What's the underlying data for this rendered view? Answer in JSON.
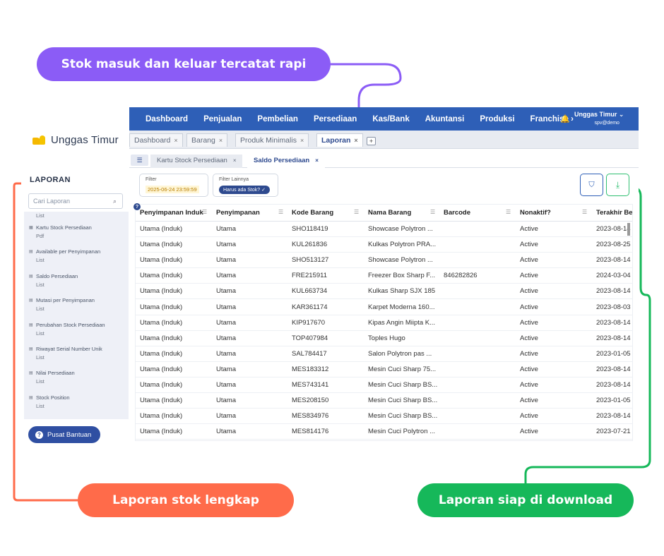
{
  "callouts": {
    "top": "Stok masuk dan keluar tercatat rapi",
    "left": "Laporan stok lengkap",
    "right": "Laporan siap di download"
  },
  "colors": {
    "purple": "#8b5cf6",
    "orange": "#ff6b4a",
    "green": "#16b85a",
    "nav_blue": "#2e5fb7"
  },
  "sidebar": {
    "logo": "Unggas Timur",
    "section_title": "LAPORAN",
    "search_placeholder": "Cari Laporan",
    "search_icon": "search-icon",
    "items": [
      {
        "title": "",
        "sub": "List"
      },
      {
        "title": "Kartu Stock Persediaan",
        "sub": "Pdf"
      },
      {
        "title": "Available per Penyimpanan",
        "sub": "List"
      },
      {
        "title": "Saldo Persediaan",
        "sub": "List"
      },
      {
        "title": "Mutasi per Penyimpanan",
        "sub": "List"
      },
      {
        "title": "Perubahan Stock Persediaan",
        "sub": "List"
      },
      {
        "title": "Riwayat Serial Number Unik",
        "sub": "List"
      },
      {
        "title": "Nilai Persediaan",
        "sub": "List"
      },
      {
        "title": "Stock Position",
        "sub": "List"
      }
    ],
    "help_button": "Pusat Bantuan"
  },
  "topnav": {
    "items": [
      "Dashboard",
      "Penjualan",
      "Pembelian",
      "Persediaan",
      "Kas/Bank",
      "Akuntansi",
      "Produksi",
      "Franchise ›"
    ],
    "user_name": "Unggas Timur ⌄",
    "user_email": "spv@demo"
  },
  "tabs": [
    {
      "label": "Dashboard",
      "close": "×"
    },
    {
      "label": "Barang",
      "close": "×"
    },
    {
      "label": "Produk Minimalis",
      "close": "×"
    },
    {
      "label": "Laporan",
      "close": "×"
    }
  ],
  "tab_add": "+",
  "subtabs": [
    {
      "label": "Kartu Stock Persediaan",
      "close": "×"
    },
    {
      "label": "Saldo Persediaan",
      "close": "×"
    }
  ],
  "filters": {
    "filter_label": "Filter",
    "filter_date": "2025-06-24 23:59:59",
    "filter_more_label": "Filter Lainnya",
    "filter_chip": "Harus ada Stok? ✓"
  },
  "table": {
    "columns": [
      "Penyimpanan Induk",
      "Penyimpanan",
      "Kode Barang",
      "Nama Barang",
      "Barcode",
      "Nonaktif?",
      "Terakhir Be"
    ],
    "rows": [
      [
        "Utama (Induk)",
        "Utama",
        "SHO118419",
        "Showcase Polytron ...",
        "",
        "Active",
        "2023-08-14"
      ],
      [
        "Utama (Induk)",
        "Utama",
        "KUL261836",
        "Kulkas Polytron PRA...",
        "",
        "Active",
        "2023-08-25"
      ],
      [
        "Utama (Induk)",
        "Utama",
        "SHO513127",
        "Showcase Polytron ...",
        "",
        "Active",
        "2023-08-14"
      ],
      [
        "Utama (Induk)",
        "Utama",
        "FRE215911",
        "Freezer Box Sharp F...",
        "846282826",
        "Active",
        "2024-03-04"
      ],
      [
        "Utama (Induk)",
        "Utama",
        "KUL663734",
        "Kulkas Sharp SJX 185",
        "",
        "Active",
        "2023-08-14"
      ],
      [
        "Utama (Induk)",
        "Utama",
        "KAR361174",
        "Karpet Moderna 160...",
        "",
        "Active",
        "2023-08-03"
      ],
      [
        "Utama (Induk)",
        "Utama",
        "KIP917670",
        "Kipas Angin Miipta K...",
        "",
        "Active",
        "2023-08-14"
      ],
      [
        "Utama (Induk)",
        "Utama",
        "TOP407984",
        "Toples Hugo",
        "",
        "Active",
        "2023-08-14"
      ],
      [
        "Utama (Induk)",
        "Utama",
        "SAL784417",
        "Salon Polytron pas ...",
        "",
        "Active",
        "2023-01-05"
      ],
      [
        "Utama (Induk)",
        "Utama",
        "MES183312",
        "Mesin Cuci Sharp 75...",
        "",
        "Active",
        "2023-08-14"
      ],
      [
        "Utama (Induk)",
        "Utama",
        "MES743141",
        "Mesin Cuci Sharp BS...",
        "",
        "Active",
        "2023-08-14"
      ],
      [
        "Utama (Induk)",
        "Utama",
        "MES208150",
        "Mesin Cuci Sharp BS...",
        "",
        "Active",
        "2023-01-05"
      ],
      [
        "Utama (Induk)",
        "Utama",
        "MES834976",
        "Mesin Cuci Sharp BS...",
        "",
        "Active",
        "2023-08-14"
      ],
      [
        "Utama (Induk)",
        "Utama",
        "MES814176",
        "Mesin Cuci Polytron ...",
        "",
        "Active",
        "2023-07-21"
      ]
    ]
  }
}
